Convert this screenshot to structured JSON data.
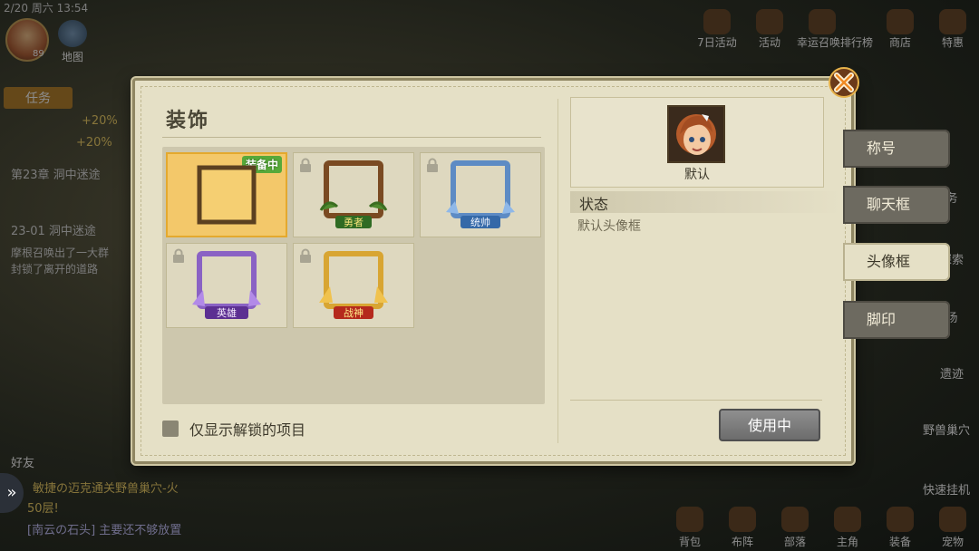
{
  "hud": {
    "status_time": "2/20 周六 13:54",
    "player_level": "89",
    "map_label": "地图",
    "top_menu": [
      "7日活动",
      "活动",
      "幸运召唤排行榜",
      "商店",
      "特惠"
    ],
    "quest_tab": "任务",
    "quest_percent_1": "+20%",
    "quest_percent_2": "+20%",
    "chapter": "第23章 洞中迷途",
    "quest_title": "23-01 洞中迷途",
    "quest_desc_1": "摩根召唤出了一大群",
    "quest_desc_2": "封锁了离开的道路",
    "right_menu": [
      "务",
      "探索",
      "场",
      "遗迹",
      "野兽巢穴",
      "快速挂机"
    ],
    "friends_label": "好友",
    "chat_1": "敏捷の迈克通关野兽巢穴-火",
    "chat_2": "50层!",
    "chat_3": "[南云の石头] 主要还不够放置",
    "bottom_menu": [
      "背包",
      "布阵",
      "部落",
      "主角",
      "装备",
      "宠物"
    ]
  },
  "panel": {
    "title": "装饰",
    "equipped_tag": "装备中",
    "frames": [
      {
        "id": "default",
        "label": "",
        "locked": false,
        "selected": true
      },
      {
        "id": "hero",
        "label": "勇者",
        "locked": true,
        "selected": false
      },
      {
        "id": "commander",
        "label": "统帅",
        "locked": true,
        "selected": false
      },
      {
        "id": "legend",
        "label": "英雄",
        "locked": true,
        "selected": false
      },
      {
        "id": "wargod",
        "label": "战神",
        "locked": true,
        "selected": false
      }
    ],
    "filter_label": "仅显示解锁的项目",
    "preview_name": "默认",
    "state_title": "状态",
    "state_desc": "默认头像框",
    "use_button": "使用中"
  },
  "side_tabs": [
    {
      "label": "称号",
      "active": false
    },
    {
      "label": "聊天框",
      "active": false
    },
    {
      "label": "头像框",
      "active": true
    },
    {
      "label": "脚印",
      "active": false
    }
  ],
  "colors": {
    "panel_bg": "#e5e0c6",
    "selected_cell": "#f3c86a",
    "equip_tag": "#57a93a",
    "tab_active": "#e5e0c6",
    "tab_inactive": "#6d6a60"
  }
}
